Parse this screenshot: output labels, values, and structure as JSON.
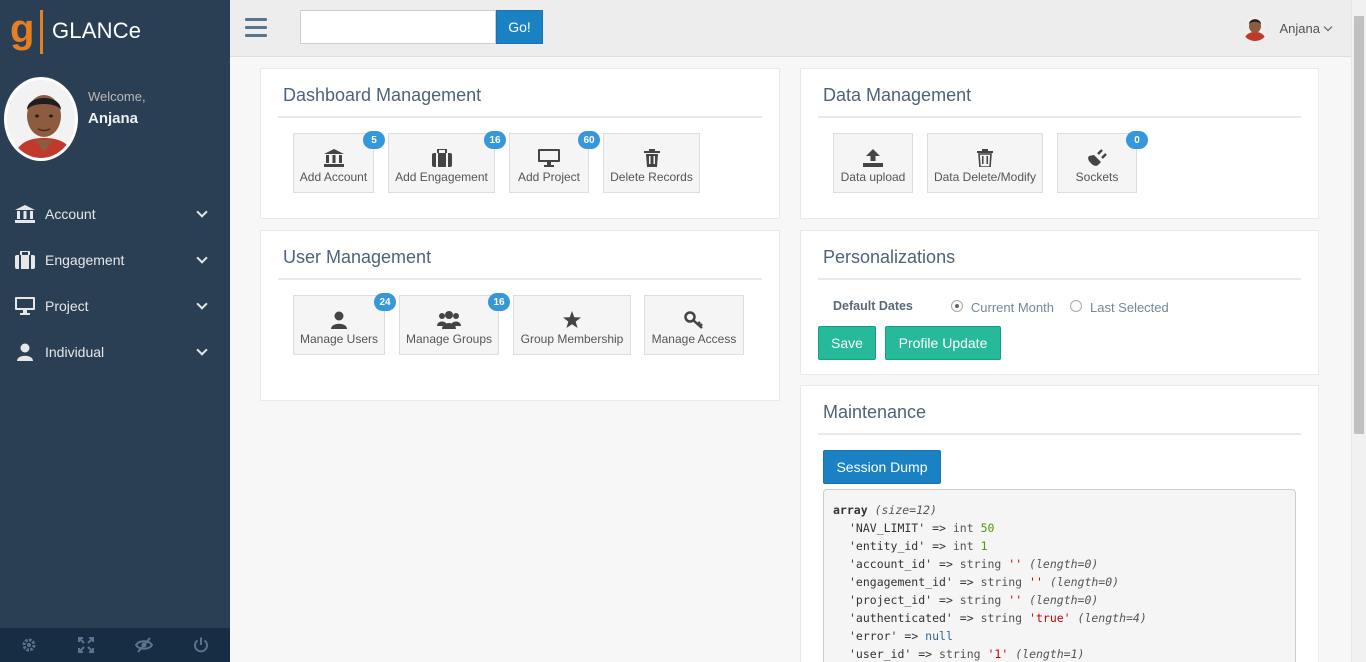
{
  "brand": {
    "name": "GLANCe"
  },
  "profile": {
    "welcome": "Welcome,",
    "name": "Anjana"
  },
  "nav": [
    {
      "label": "Account",
      "icon": "bank-icon"
    },
    {
      "label": "Engagement",
      "icon": "briefcase-icon"
    },
    {
      "label": "Project",
      "icon": "monitor-icon"
    },
    {
      "label": "Individual",
      "icon": "user-icon"
    }
  ],
  "footer": [
    "gear-icon",
    "fullscreen-icon",
    "eye-slash-icon",
    "power-icon"
  ],
  "topnav": {
    "search_placeholder": "",
    "go_label": "Go!",
    "user_name": "Anjana"
  },
  "dashboard": {
    "title": "Dashboard Management",
    "tiles": [
      {
        "label": "Add Account",
        "badge": "5",
        "icon": "bank-icon"
      },
      {
        "label": "Add Engagement",
        "badge": "16",
        "icon": "briefcase-icon"
      },
      {
        "label": "Add Project",
        "badge": "60",
        "icon": "monitor-icon"
      },
      {
        "label": "Delete Records",
        "badge": "",
        "icon": "trash-icon"
      }
    ]
  },
  "users": {
    "title": "User Management",
    "tiles": [
      {
        "label": "Manage Users",
        "badge": "24",
        "icon": "user-icon"
      },
      {
        "label": "Manage Groups",
        "badge": "16",
        "icon": "users-icon"
      },
      {
        "label": "Group Membership",
        "badge": "",
        "icon": "star-icon"
      },
      {
        "label": "Manage Access",
        "badge": "",
        "icon": "key-icon"
      }
    ]
  },
  "data": {
    "title": "Data Management",
    "tiles": [
      {
        "label": "Data upload",
        "badge": "",
        "icon": "upload-icon"
      },
      {
        "label": "Data Delete/Modify",
        "badge": "",
        "icon": "trash-icon"
      },
      {
        "label": "Sockets",
        "badge": "0",
        "icon": "plug-icon"
      }
    ]
  },
  "personal": {
    "title": "Personalizations",
    "default_dates_label": "Default Dates",
    "options": [
      {
        "label": "Current Month",
        "checked": true
      },
      {
        "label": "Last Selected",
        "checked": false
      }
    ],
    "save_label": "Save",
    "profile_label": "Profile Update"
  },
  "maintenance": {
    "title": "Maintenance",
    "session_dump_label": "Session Dump",
    "dump_header": {
      "word": "array",
      "meta": "(size=12)"
    },
    "dump_lines": [
      {
        "key": "'NAV_LIMIT'",
        "type": "int",
        "value": "50",
        "kind": "num",
        "meta": ""
      },
      {
        "key": "'entity_id'",
        "type": "int",
        "value": "1",
        "kind": "num",
        "meta": ""
      },
      {
        "key": "'account_id'",
        "type": "string",
        "value": "''",
        "kind": "str",
        "meta": "(length=0)"
      },
      {
        "key": "'engagement_id'",
        "type": "string",
        "value": "''",
        "kind": "str",
        "meta": "(length=0)"
      },
      {
        "key": "'project_id'",
        "type": "string",
        "value": "''",
        "kind": "str",
        "meta": "(length=0)"
      },
      {
        "key": "'authenticated'",
        "type": "string",
        "value": "'true'",
        "kind": "str",
        "meta": "(length=4)"
      },
      {
        "key": "'error'",
        "type": "",
        "value": "null",
        "kind": "nul",
        "meta": ""
      },
      {
        "key": "'user_id'",
        "type": "string",
        "value": "'1'",
        "kind": "str",
        "meta": "(length=1)"
      }
    ]
  },
  "colors": {
    "sidebar": "#2a3f54",
    "accent_blue": "#1a82c3",
    "accent_green": "#26b99a",
    "badge": "#3498db",
    "brand_orange": "#e67e22"
  }
}
